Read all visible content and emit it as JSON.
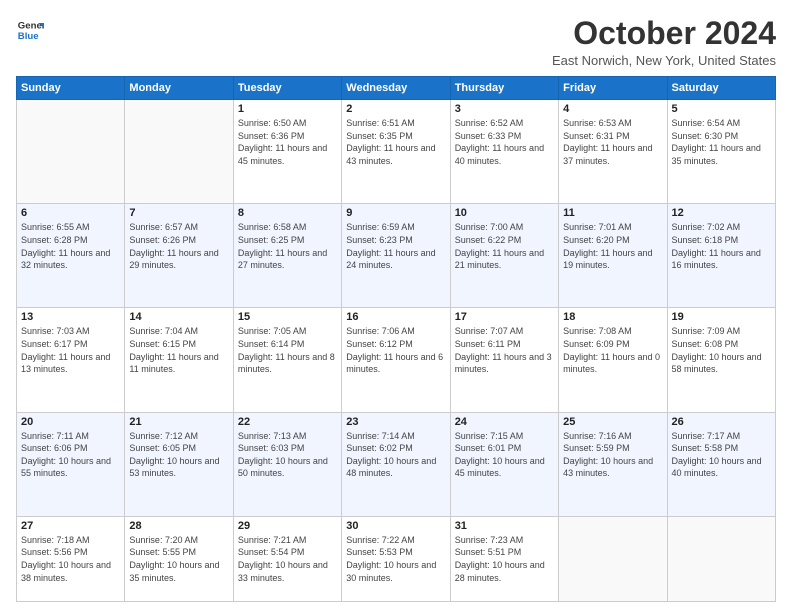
{
  "header": {
    "logo_line1": "General",
    "logo_line2": "Blue",
    "title": "October 2024",
    "subtitle": "East Norwich, New York, United States"
  },
  "days_of_week": [
    "Sunday",
    "Monday",
    "Tuesday",
    "Wednesday",
    "Thursday",
    "Friday",
    "Saturday"
  ],
  "weeks": [
    [
      {
        "day": "",
        "sunrise": "",
        "sunset": "",
        "daylight": ""
      },
      {
        "day": "",
        "sunrise": "",
        "sunset": "",
        "daylight": ""
      },
      {
        "day": "1",
        "sunrise": "Sunrise: 6:50 AM",
        "sunset": "Sunset: 6:36 PM",
        "daylight": "Daylight: 11 hours and 45 minutes."
      },
      {
        "day": "2",
        "sunrise": "Sunrise: 6:51 AM",
        "sunset": "Sunset: 6:35 PM",
        "daylight": "Daylight: 11 hours and 43 minutes."
      },
      {
        "day": "3",
        "sunrise": "Sunrise: 6:52 AM",
        "sunset": "Sunset: 6:33 PM",
        "daylight": "Daylight: 11 hours and 40 minutes."
      },
      {
        "day": "4",
        "sunrise": "Sunrise: 6:53 AM",
        "sunset": "Sunset: 6:31 PM",
        "daylight": "Daylight: 11 hours and 37 minutes."
      },
      {
        "day": "5",
        "sunrise": "Sunrise: 6:54 AM",
        "sunset": "Sunset: 6:30 PM",
        "daylight": "Daylight: 11 hours and 35 minutes."
      }
    ],
    [
      {
        "day": "6",
        "sunrise": "Sunrise: 6:55 AM",
        "sunset": "Sunset: 6:28 PM",
        "daylight": "Daylight: 11 hours and 32 minutes."
      },
      {
        "day": "7",
        "sunrise": "Sunrise: 6:57 AM",
        "sunset": "Sunset: 6:26 PM",
        "daylight": "Daylight: 11 hours and 29 minutes."
      },
      {
        "day": "8",
        "sunrise": "Sunrise: 6:58 AM",
        "sunset": "Sunset: 6:25 PM",
        "daylight": "Daylight: 11 hours and 27 minutes."
      },
      {
        "day": "9",
        "sunrise": "Sunrise: 6:59 AM",
        "sunset": "Sunset: 6:23 PM",
        "daylight": "Daylight: 11 hours and 24 minutes."
      },
      {
        "day": "10",
        "sunrise": "Sunrise: 7:00 AM",
        "sunset": "Sunset: 6:22 PM",
        "daylight": "Daylight: 11 hours and 21 minutes."
      },
      {
        "day": "11",
        "sunrise": "Sunrise: 7:01 AM",
        "sunset": "Sunset: 6:20 PM",
        "daylight": "Daylight: 11 hours and 19 minutes."
      },
      {
        "day": "12",
        "sunrise": "Sunrise: 7:02 AM",
        "sunset": "Sunset: 6:18 PM",
        "daylight": "Daylight: 11 hours and 16 minutes."
      }
    ],
    [
      {
        "day": "13",
        "sunrise": "Sunrise: 7:03 AM",
        "sunset": "Sunset: 6:17 PM",
        "daylight": "Daylight: 11 hours and 13 minutes."
      },
      {
        "day": "14",
        "sunrise": "Sunrise: 7:04 AM",
        "sunset": "Sunset: 6:15 PM",
        "daylight": "Daylight: 11 hours and 11 minutes."
      },
      {
        "day": "15",
        "sunrise": "Sunrise: 7:05 AM",
        "sunset": "Sunset: 6:14 PM",
        "daylight": "Daylight: 11 hours and 8 minutes."
      },
      {
        "day": "16",
        "sunrise": "Sunrise: 7:06 AM",
        "sunset": "Sunset: 6:12 PM",
        "daylight": "Daylight: 11 hours and 6 minutes."
      },
      {
        "day": "17",
        "sunrise": "Sunrise: 7:07 AM",
        "sunset": "Sunset: 6:11 PM",
        "daylight": "Daylight: 11 hours and 3 minutes."
      },
      {
        "day": "18",
        "sunrise": "Sunrise: 7:08 AM",
        "sunset": "Sunset: 6:09 PM",
        "daylight": "Daylight: 11 hours and 0 minutes."
      },
      {
        "day": "19",
        "sunrise": "Sunrise: 7:09 AM",
        "sunset": "Sunset: 6:08 PM",
        "daylight": "Daylight: 10 hours and 58 minutes."
      }
    ],
    [
      {
        "day": "20",
        "sunrise": "Sunrise: 7:11 AM",
        "sunset": "Sunset: 6:06 PM",
        "daylight": "Daylight: 10 hours and 55 minutes."
      },
      {
        "day": "21",
        "sunrise": "Sunrise: 7:12 AM",
        "sunset": "Sunset: 6:05 PM",
        "daylight": "Daylight: 10 hours and 53 minutes."
      },
      {
        "day": "22",
        "sunrise": "Sunrise: 7:13 AM",
        "sunset": "Sunset: 6:03 PM",
        "daylight": "Daylight: 10 hours and 50 minutes."
      },
      {
        "day": "23",
        "sunrise": "Sunrise: 7:14 AM",
        "sunset": "Sunset: 6:02 PM",
        "daylight": "Daylight: 10 hours and 48 minutes."
      },
      {
        "day": "24",
        "sunrise": "Sunrise: 7:15 AM",
        "sunset": "Sunset: 6:01 PM",
        "daylight": "Daylight: 10 hours and 45 minutes."
      },
      {
        "day": "25",
        "sunrise": "Sunrise: 7:16 AM",
        "sunset": "Sunset: 5:59 PM",
        "daylight": "Daylight: 10 hours and 43 minutes."
      },
      {
        "day": "26",
        "sunrise": "Sunrise: 7:17 AM",
        "sunset": "Sunset: 5:58 PM",
        "daylight": "Daylight: 10 hours and 40 minutes."
      }
    ],
    [
      {
        "day": "27",
        "sunrise": "Sunrise: 7:18 AM",
        "sunset": "Sunset: 5:56 PM",
        "daylight": "Daylight: 10 hours and 38 minutes."
      },
      {
        "day": "28",
        "sunrise": "Sunrise: 7:20 AM",
        "sunset": "Sunset: 5:55 PM",
        "daylight": "Daylight: 10 hours and 35 minutes."
      },
      {
        "day": "29",
        "sunrise": "Sunrise: 7:21 AM",
        "sunset": "Sunset: 5:54 PM",
        "daylight": "Daylight: 10 hours and 33 minutes."
      },
      {
        "day": "30",
        "sunrise": "Sunrise: 7:22 AM",
        "sunset": "Sunset: 5:53 PM",
        "daylight": "Daylight: 10 hours and 30 minutes."
      },
      {
        "day": "31",
        "sunrise": "Sunrise: 7:23 AM",
        "sunset": "Sunset: 5:51 PM",
        "daylight": "Daylight: 10 hours and 28 minutes."
      },
      {
        "day": "",
        "sunrise": "",
        "sunset": "",
        "daylight": ""
      },
      {
        "day": "",
        "sunrise": "",
        "sunset": "",
        "daylight": ""
      }
    ]
  ]
}
